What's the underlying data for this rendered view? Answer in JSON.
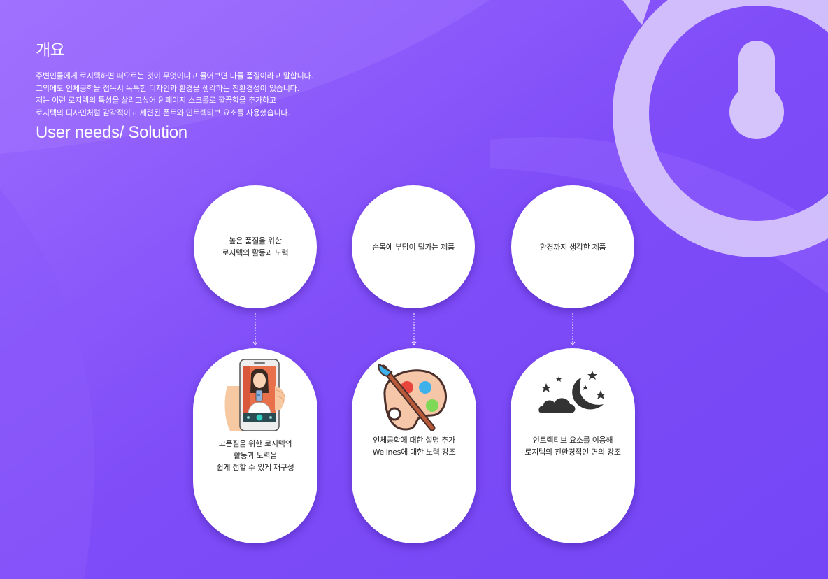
{
  "overview": {
    "title": "개요",
    "lines": [
      "주변인들에게 로지텍하면 떠오르는 것이 무엇이냐고 물어보면 다들 품질이라고 말합니다.",
      "그외에도 인체공학을 접목시 독특한 디자인과 환경을 생각하는 친환경성이 있습니다.",
      "저는 이런 로지텍의 특성을 살리고싶어 원페이지 스크롤로 깔끔함을 추가하고",
      "로지텍의 디자인처럼 감각적이고 세련된 폰트와 인트렉티브 요소를 사용했습니다."
    ]
  },
  "needs_title": "User needs/ Solution",
  "needs": [
    "높은 품질을 위한\n로지텍의 활동과 노력",
    "손목에 부담이 덜가는 제품",
    "환경까지 생각한 제품"
  ],
  "solutions": [
    {
      "text": "고품질을 위한 로지텍의\n활동과 노력을\n쉽게 접할 수 있게 재구성",
      "icon": "selfie-phone-icon"
    },
    {
      "text": "인체공학에 대한 설명 추가\nWellnes에 대한 노력 강조",
      "icon": "paint-palette-icon"
    },
    {
      "text": "인트렉티브 요소를 이용해\n로지텍의 친환경적인 면의 강조",
      "icon": "night-moon-cloud-icon"
    }
  ],
  "colors": {
    "background": "#7a4bf7",
    "background_light": "#a06cff",
    "card": "#ffffff",
    "text_dark": "#222222"
  }
}
